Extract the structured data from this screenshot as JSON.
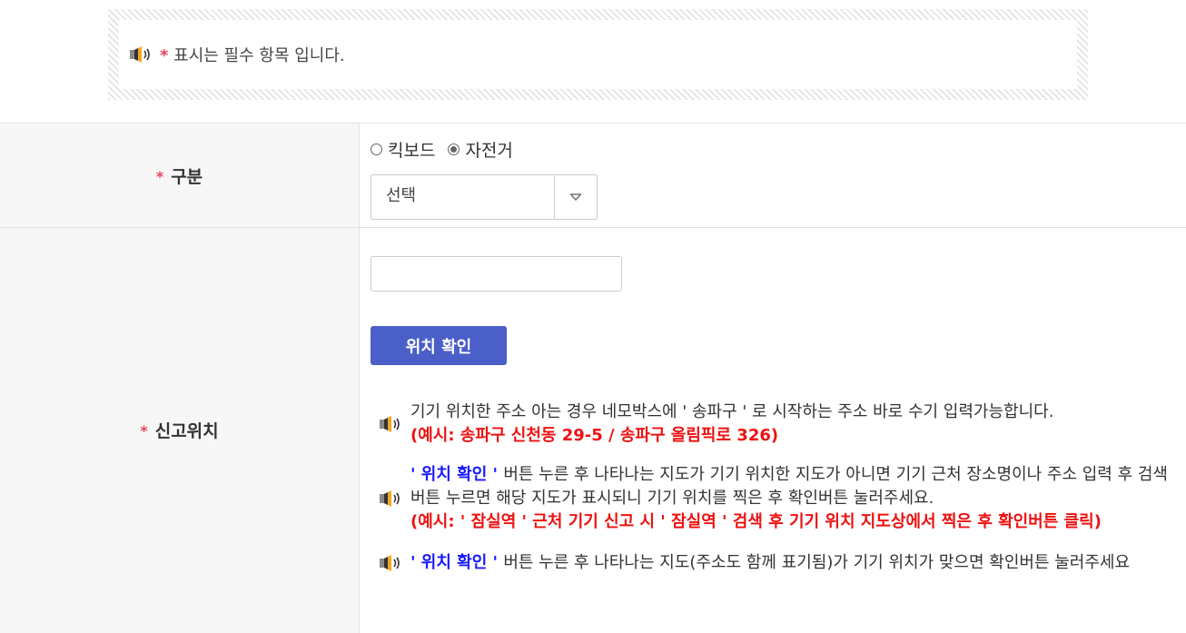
{
  "notice": {
    "star": "*",
    "text": "표시는 필수 항목 입니다."
  },
  "form": {
    "category": {
      "label": "구분",
      "star": "*",
      "radios": [
        {
          "label": "킥보드",
          "checked": false
        },
        {
          "label": "자전거",
          "checked": true
        }
      ],
      "select_value": "선택"
    },
    "location": {
      "label": "신고위치",
      "star": "*",
      "input_value": "",
      "button_label": "위치 확인",
      "guide1": {
        "text": "기기 위치한 주소 아는 경우 네모박스에 ' 송파구 ' 로 시작하는 주소 바로 수기 입력가능합니다.",
        "example": "(예시: 송파구 신천동 29-5 / 송파구 올림픽로 326)"
      },
      "guide2": {
        "highlight": " ' 위치 확인 ' ",
        "text": " 버튼 누른 후 나타나는 지도가 기기 위치한 지도가 아니면 기기 근처 장소명이나 주소 입력 후 검색 버튼 누르면 해당 지도가 표시되니 기기 위치를 찍은 후 확인버튼 눌러주세요.",
        "example": "(예시:  ' 잠실역 ' 근처 기기 신고 시 ' 잠실역 ' 검색 후 기기 위치 지도상에서 찍은 후 확인버튼 클릭)"
      },
      "guide3": {
        "highlight": " ' 위치 확인 ' ",
        "text": " 버튼 누른 후 나타나는 지도(주소도 함께 표기됨)가 기기 위치가 맞으면 확인버튼 눌러주세요"
      }
    }
  },
  "colors": {
    "required_star": "#e8465f",
    "button_bg": "#4a5fc8",
    "highlight_blue": "#1a1aff",
    "example_red": "#ee1111"
  },
  "icons": {
    "notice": "speaker-icon",
    "select_arrow": "chevron-down-icon"
  }
}
